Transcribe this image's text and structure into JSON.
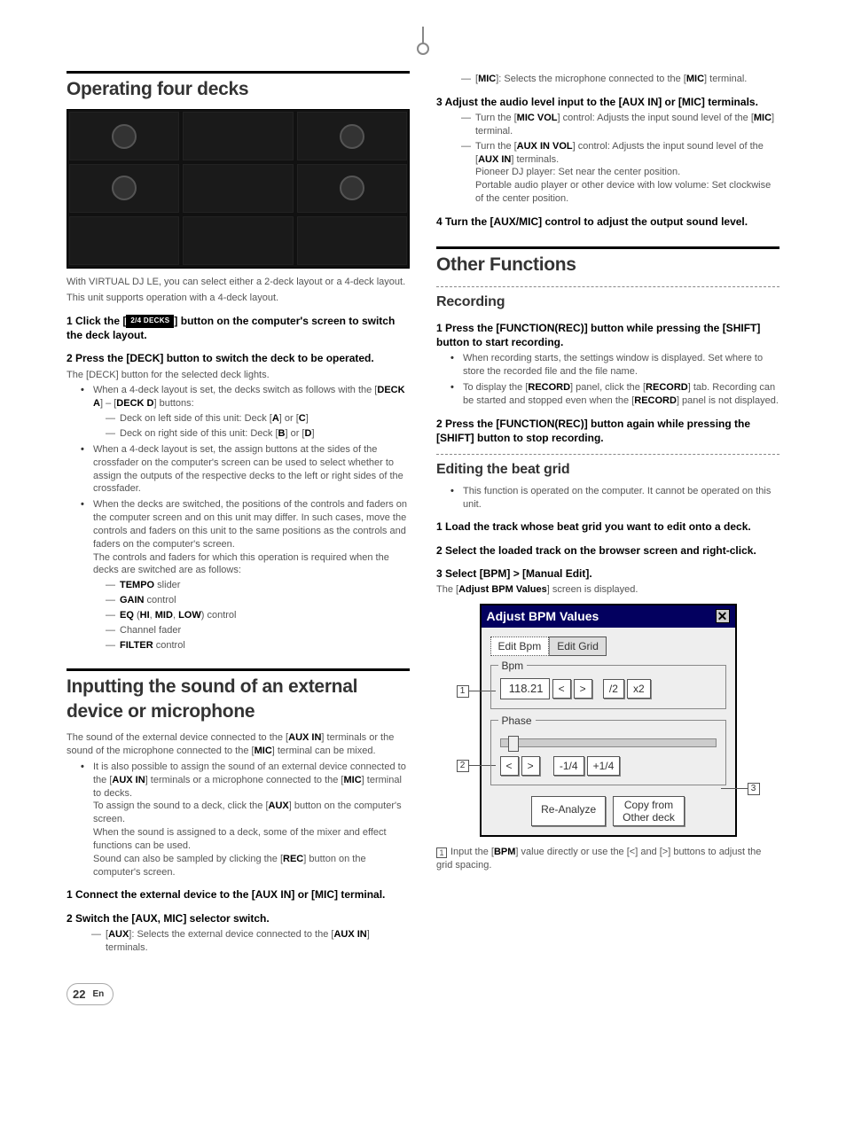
{
  "left": {
    "h1": "Operating four decks",
    "intro1": "With VIRTUAL DJ LE, you can select either a 2-deck layout or a 4-deck layout.",
    "intro2": "This unit supports operation with a 4-deck layout.",
    "step1_pre": "1   Click the [",
    "step1_btn": "2/4 DECKS",
    "step1_post": "] button on the computer's screen to switch the deck layout.",
    "step2": "2   Press the [DECK] button to switch the deck to be operated.",
    "step2_sub": "The [DECK] button for the selected deck lights.",
    "b1": "When a 4-deck layout is set, the decks switch as follows with the [DECK A] – [DECK D] buttons:",
    "d1": "Deck on left side of this unit: Deck [A] or [C]",
    "d2": "Deck on right side of this unit: Deck [B] or [D]",
    "b2": "When a 4-deck layout is set, the assign buttons at the sides of the crossfader on the computer's screen can be used to select whether to assign the outputs of the respective decks to the left or right sides of the crossfader.",
    "b3": "When the decks are switched, the positions of the controls and faders on the computer screen and on this unit may differ. In such cases, move the controls and faders on this unit to the same positions as the controls and faders on the computer's screen.",
    "b3b": "The controls and faders for which this operation is required when the decks are switched are as follows:",
    "ctl1": "TEMPO slider",
    "ctl2": "GAIN control",
    "ctl3_pre": "EQ (",
    "ctl3_mid": "HI, MID, LOW",
    "ctl3_post": ") control",
    "ctl4": "Channel fader",
    "ctl5": "FILTER control",
    "h1b": "Inputting the sound of an external device or microphone",
    "ext1": "The sound of the external device connected to the [AUX IN] terminals or the sound of the microphone connected to the [MIC] terminal can be mixed.",
    "extb1": "It is also possible to assign the sound of an external device connected to the [AUX IN] terminals or a microphone connected to the [MIC] terminal to decks.",
    "extb1b": "To assign the sound to a deck, click the [AUX] button on the computer's screen.",
    "extb1c": "When the sound is assigned to a deck, some of the mixer and effect functions can be used.",
    "extb1d": "Sound can also be sampled by clicking the [REC] button on the computer's screen.",
    "ext_s1": "1   Connect the external device to the [AUX IN] or [MIC] terminal.",
    "ext_s2": "2   Switch the [AUX, MIC] selector switch.",
    "ext_d1": "[AUX]: Selects the external device connected to the [AUX IN] terminals."
  },
  "right": {
    "mic_d": "[MIC]: Selects the microphone connected to the [MIC] terminal.",
    "s3": "3   Adjust the audio level input to the [AUX IN] or [MIC] terminals.",
    "s3d1": "Turn the [MIC VOL] control: Adjusts the input sound level of the [MIC] terminal.",
    "s3d2": "Turn the [AUX IN VOL] control: Adjusts the input sound level of the [AUX IN] terminals.",
    "s3d2b": "Pioneer DJ player: Set near the center position.",
    "s3d2c": "Portable audio player or other device with low volume: Set clockwise of the center position.",
    "s4": "4   Turn the [AUX/MIC] control to adjust the output sound level.",
    "h1": "Other Functions",
    "h2a": "Recording",
    "rec_s1": "1   Press the [FUNCTION(REC)] button while pressing the [SHIFT] button to start recording.",
    "rec_b1": "When recording starts, the settings window is displayed. Set where to store the recorded file and the file name.",
    "rec_b2": "To display the [RECORD] panel, click the [RECORD] tab. Recording can be started and stopped even when the [RECORD] panel is not displayed.",
    "rec_s2": "2   Press the [FUNCTION(REC)] button again while pressing the [SHIFT] button to stop recording.",
    "h2b": "Editing the beat grid",
    "bg_b1": "This function is operated on the computer. It cannot be operated on this unit.",
    "bg_s1": "1   Load the track whose beat grid you want to edit onto a deck.",
    "bg_s2": "2   Select the loaded track on the browser screen and right-click.",
    "bg_s3": "3   Select [BPM] > [Manual Edit].",
    "bg_s3b": "The [Adjust BPM Values] screen is displayed.",
    "win_title": "Adjust BPM Values",
    "tab1": "Edit Bpm",
    "tab2": "Edit Grid",
    "leg1": "Bpm",
    "bpm_val": "118.21",
    "half": "/2",
    "dbl": "x2",
    "leg2": "Phase",
    "m14": "-1/4",
    "p14": "+1/4",
    "rean": "Re-Analyze",
    "copy": "Copy from Other deck",
    "foot1": "Input the [BPM] value directly or use the [ < ] and [ > ] buttons to adjust the grid spacing."
  },
  "page": {
    "num": "22",
    "lang": "En"
  }
}
